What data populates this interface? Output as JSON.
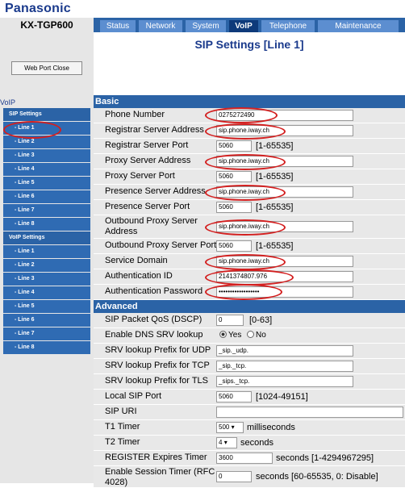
{
  "brand": "Panasonic",
  "model": "KX-TGP600",
  "web_port_close": "Web Port Close",
  "nav": {
    "section": "VoIP",
    "groups": [
      {
        "label": "SIP Settings",
        "items": [
          "- Line 1",
          "- Line 2",
          "- Line 3",
          "- Line 4",
          "- Line 5",
          "- Line 6",
          "- Line 7",
          "- Line 8"
        ]
      },
      {
        "label": "VoIP Settings",
        "items": [
          "- Line 1",
          "- Line 2",
          "- Line 3",
          "- Line 4",
          "- Line 5",
          "- Line 6",
          "- Line 7",
          "- Line 8"
        ]
      }
    ]
  },
  "tabs": [
    "Status",
    "Network",
    "System",
    "VoIP",
    "Telephone",
    "Maintenance"
  ],
  "active_tab": "VoIP",
  "page_title": "SIP Settings [Line 1]",
  "basic": {
    "heading": "Basic",
    "phone_number": {
      "label": "Phone Number",
      "value": "0275272490"
    },
    "registrar_address": {
      "label": "Registrar Server Address",
      "value": "sip.phone.iway.ch"
    },
    "registrar_port": {
      "label": "Registrar Server Port",
      "value": "5060",
      "range": "[1-65535]"
    },
    "proxy_address": {
      "label": "Proxy Server Address",
      "value": "sip.phone.iway.ch"
    },
    "proxy_port": {
      "label": "Proxy Server Port",
      "value": "5060",
      "range": "[1-65535]"
    },
    "presence_address": {
      "label": "Presence Server Address",
      "value": "sip.phone.iway.ch"
    },
    "presence_port": {
      "label": "Presence Server Port",
      "value": "5060",
      "range": "[1-65535]"
    },
    "outbound_address": {
      "label_l1": "Outbound Proxy Server",
      "label_l2": "Address",
      "value": "sip.phone.iway.ch"
    },
    "outbound_port": {
      "label": "Outbound Proxy Server Port",
      "value": "5060",
      "range": "[1-65535]"
    },
    "service_domain": {
      "label": "Service Domain",
      "value": "sip.phone.iway.ch"
    },
    "auth_id": {
      "label": "Authentication ID",
      "value": "2141374807.976"
    },
    "auth_password": {
      "label": "Authentication Password",
      "value": "••••••••••••••••••"
    }
  },
  "advanced": {
    "heading": "Advanced",
    "qos": {
      "label": "SIP Packet QoS (DSCP)",
      "value": "0",
      "range": "[0-63]"
    },
    "dns_srv": {
      "label": "Enable DNS SRV lookup",
      "yes": "Yes",
      "no": "No",
      "selected": "Yes"
    },
    "srv_udp": {
      "label": "SRV lookup Prefix for UDP",
      "value": "_sip._udp."
    },
    "srv_tcp": {
      "label": "SRV lookup Prefix for TCP",
      "value": "_sip._tcp."
    },
    "srv_tls": {
      "label": "SRV lookup Prefix for TLS",
      "value": "_sips._tcp."
    },
    "local_port": {
      "label": "Local SIP Port",
      "value": "5060",
      "range": "[1024-49151]"
    },
    "sip_uri": {
      "label": "SIP URI",
      "value": ""
    },
    "t1": {
      "label": "T1 Timer",
      "value": "500",
      "unit": "milliseconds"
    },
    "t2": {
      "label": "T2 Timer",
      "value": "4",
      "unit": "seconds"
    },
    "register_expires": {
      "label": "REGISTER Expires Timer",
      "value": "3600",
      "range": "seconds [1-4294967295]"
    },
    "session_timer": {
      "label_l1": "Enable Session Timer (RFC",
      "label_l2": "4028)",
      "value": "0",
      "range": "seconds [60-65535, 0: Disable]"
    }
  },
  "annotation_color": "#d31f1f",
  "accent_color": "#2b63a6"
}
